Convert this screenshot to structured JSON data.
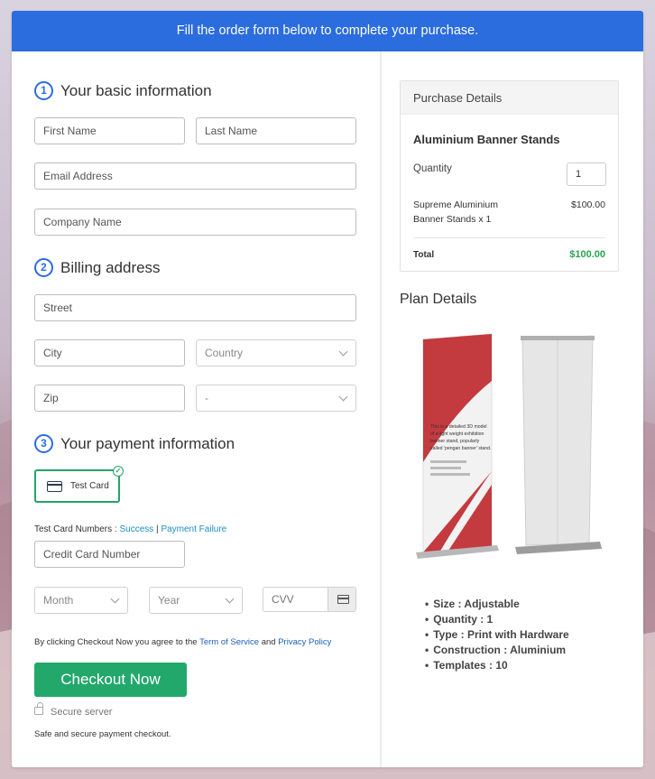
{
  "banner": {
    "text": "Fill the order form below to complete your purchase."
  },
  "basic_info": {
    "step": "1",
    "title": "Your basic information",
    "first_name_placeholder": "First Name",
    "last_name_placeholder": "Last Name",
    "email_placeholder": "Email Address",
    "company_placeholder": "Company Name"
  },
  "billing": {
    "step": "2",
    "title": "Billing address",
    "street_placeholder": "Street",
    "city_placeholder": "City",
    "country_value": "Country",
    "zip_placeholder": "Zip",
    "state_value": "-"
  },
  "payment": {
    "step": "3",
    "title": "Your payment information",
    "test_card_label": "Test Card",
    "test_numbers_label": "Test Card Numbers : ",
    "success_link": "Success",
    "separator": " | ",
    "failure_link": "Payment Failure",
    "card_number_placeholder": "Credit Card Number",
    "month_value": "Month",
    "year_value": "Year",
    "cvv_placeholder": "CVV"
  },
  "agreement": {
    "prefix": "By clicking Checkout Now you agree to the ",
    "terms_link": "Term of Service",
    "and": " and ",
    "privacy_link": "Privacy Policy"
  },
  "checkout": {
    "button_label": "Checkout Now",
    "secure_label": "Secure server",
    "safe_text": "Safe and secure payment checkout."
  },
  "purchase_details": {
    "header": "Purchase Details",
    "product_name": "Aluminium Banner Stands",
    "quantity_label": "Quantity",
    "quantity_value": "1",
    "line_item_line1": "Supreme Aluminium",
    "line_item_line2": "Banner Stands x 1",
    "line_item_price": "$100.00",
    "total_label": "Total",
    "total_value": "$100.00"
  },
  "plan_details": {
    "title": "Plan Details",
    "product_image_text_line1": "This is a detailed 3D model",
    "product_image_text_line2": "of a light weight exhibition",
    "product_image_text_line3": "banner stand, popularly",
    "product_image_text_line4": "called 'pengan banner' stand.",
    "features": [
      "Size : Adjustable",
      "Quantity : 1",
      "Type : Print with Hardware",
      "Construction : Aluminium",
      "Templates : 10"
    ]
  },
  "colors": {
    "accent_blue": "#2b6cdf",
    "checkout_green": "#23a86b",
    "total_green": "#27a34f",
    "link_teal": "#1a8fbf"
  }
}
